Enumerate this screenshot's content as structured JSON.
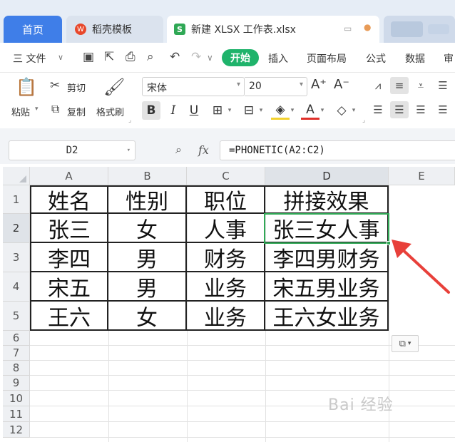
{
  "tabs": {
    "home": "首页",
    "stencil": "稻壳模板",
    "file": "新建 XLSX 工作表.xlsx"
  },
  "menu": {
    "file": "三 文件",
    "start": "开始",
    "insert": "插入",
    "page_layout": "页面布局",
    "formula": "公式",
    "data": "数据",
    "review": "审"
  },
  "ribbon": {
    "paste": "粘贴",
    "cut": "剪切",
    "copy": "复制",
    "format_painter": "格式刷",
    "font_name": "宋体",
    "font_size": "20",
    "bold": "B",
    "italic": "I",
    "underline": "U",
    "grow_font": "A⁺",
    "shrink_font": "A⁻"
  },
  "formula_bar": {
    "name_box": "D2",
    "fx": "fx",
    "formula": "=PHONETIC(A2:C2)"
  },
  "sheet": {
    "columns": [
      "A",
      "B",
      "C",
      "D",
      "E"
    ],
    "rows": [
      "1",
      "2",
      "3",
      "4",
      "5",
      "6",
      "7",
      "8",
      "9",
      "10",
      "11",
      "12"
    ],
    "active_cell": "D2",
    "table": [
      [
        "姓名",
        "性别",
        "职位",
        "拼接效果"
      ],
      [
        "张三",
        "女",
        "人事",
        "张三女人事"
      ],
      [
        "李四",
        "男",
        "财务",
        "李四男财务"
      ],
      [
        "宋五",
        "男",
        "业务",
        "宋五男业务"
      ],
      [
        "王六",
        "女",
        "业务",
        "王六女业务"
      ]
    ]
  },
  "watermark": "Bai 经验",
  "colors": {
    "accent": "#3f7ee8",
    "start_green": "#1fb36b",
    "selection_green": "#2fa855",
    "arrow_red": "#e8403a"
  }
}
